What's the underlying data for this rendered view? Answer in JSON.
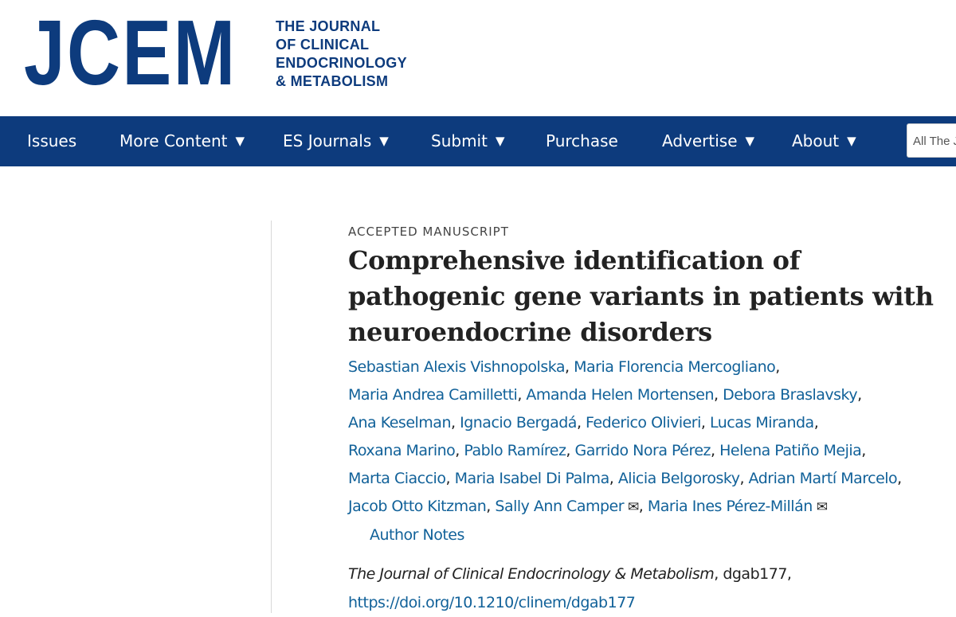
{
  "header": {
    "logo_mark": "JCEM",
    "logo_text_lines": [
      "THE JOURNAL",
      "OF CLINICAL",
      "ENDOCRINOLOGY",
      "& METABOLISM"
    ]
  },
  "nav": {
    "items": [
      {
        "label": "Issues"
      },
      {
        "label": "More Content"
      },
      {
        "label": "ES Journals"
      },
      {
        "label": "Submit"
      },
      {
        "label": "Purchase"
      },
      {
        "label": "Advertise"
      },
      {
        "label": "About"
      }
    ],
    "caret": "▼",
    "search_scope": "All The Jo"
  },
  "article": {
    "kicker": "ACCEPTED MANUSCRIPT",
    "title": "Comprehensive identification of pathogenic gene variants in patients with neuroendocrine disorders",
    "authors": [
      "Sebastian Alexis Vishnopolska",
      "Maria Florencia Mercogliano",
      "Maria Andrea Camilletti",
      "Amanda Helen Mortensen",
      "Debora Braslavsky",
      "Ana Keselman",
      "Ignacio Bergadá",
      "Federico Olivieri",
      "Lucas Miranda",
      "Roxana Marino",
      "Pablo Ramírez",
      "Garrido Nora Pérez",
      "Helena Patiño Mejia",
      "Marta Ciaccio",
      "Maria Isabel Di Palma",
      "Alicia Belgorosky",
      "Adrian Martí Marcelo",
      "Jacob Otto Kitzman",
      "Sally Ann Camper",
      "Maria Ines Pérez-Millán"
    ],
    "separator": ",",
    "mail_icon": "✉",
    "author_notes": "Author Notes",
    "journal_name": "The Journal of Clinical Endocrinology & Metabolism",
    "article_id": ", dgab177,",
    "doi": "https://doi.org/10.1210/clinem/dgab177"
  }
}
